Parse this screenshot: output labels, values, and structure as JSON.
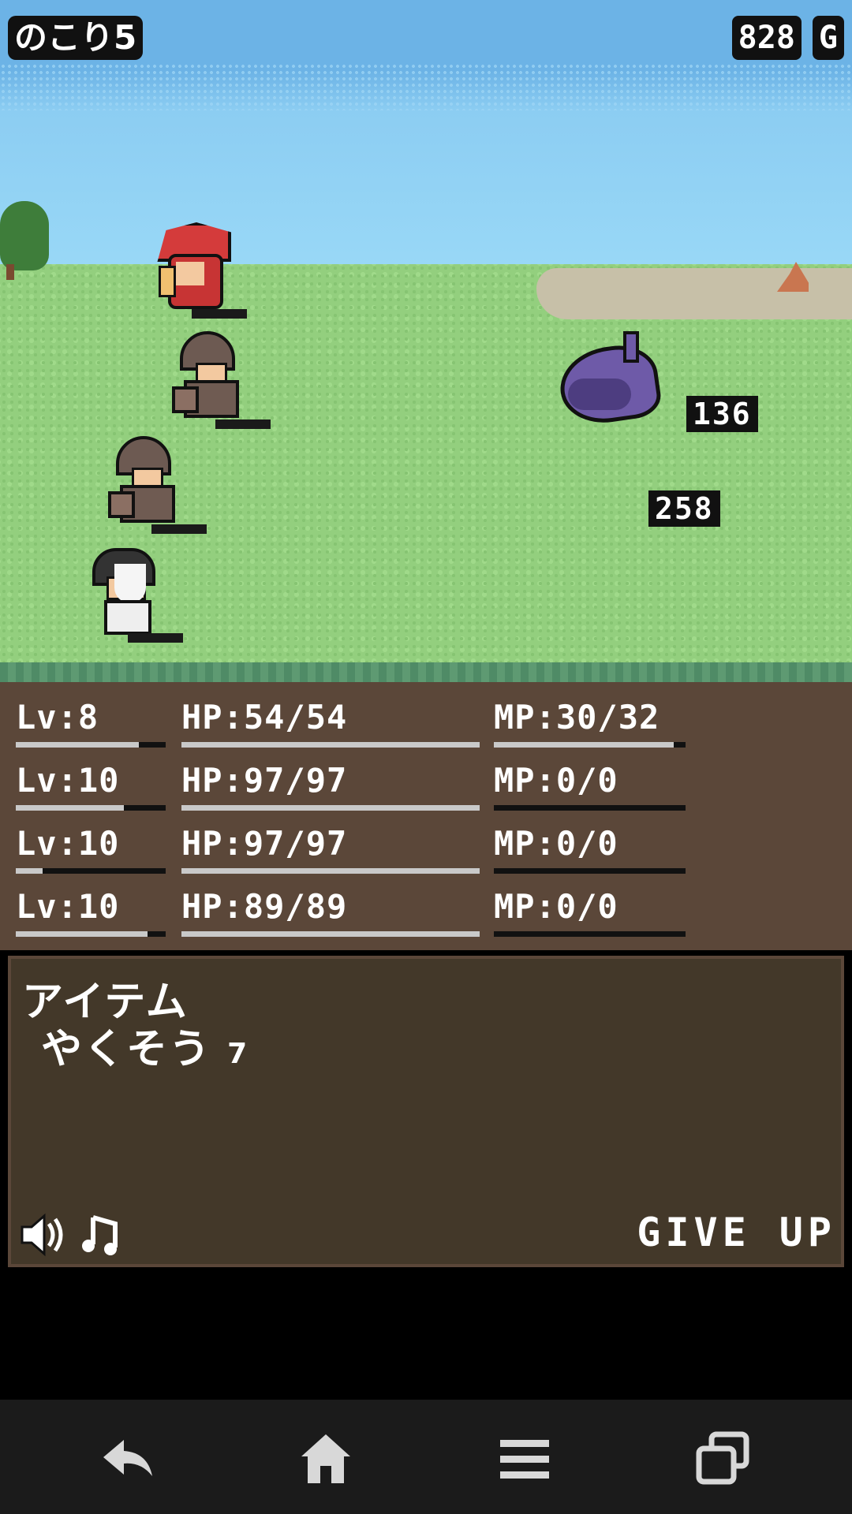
{
  "hud": {
    "remaining_label": "のこり5",
    "gold_value": "828",
    "gold_unit": "G"
  },
  "battle": {
    "damage_numbers": [
      "136",
      "258"
    ]
  },
  "party": [
    {
      "level": "Lv:8",
      "hp": "HP:54/54",
      "mp": "MP:30/32",
      "exp_fraction": 0.82,
      "hp_fraction": 1.0,
      "mp_fraction": 0.94
    },
    {
      "level": "Lv:10",
      "hp": "HP:97/97",
      "mp": "MP:0/0",
      "exp_fraction": 0.72,
      "hp_fraction": 1.0,
      "mp_fraction": 0
    },
    {
      "level": "Lv:10",
      "hp": "HP:97/97",
      "mp": "MP:0/0",
      "exp_fraction": 0.18,
      "hp_fraction": 1.0,
      "mp_fraction": 0
    },
    {
      "level": "Lv:10",
      "hp": "HP:89/89",
      "mp": "MP:0/0",
      "exp_fraction": 0.88,
      "hp_fraction": 1.0,
      "mp_fraction": 0
    }
  ],
  "message": {
    "line1": "アイテム",
    "line2": "やくそう",
    "line2_count": "7"
  },
  "controls": {
    "give_up_label": "GIVE UP",
    "sound_icon": "speaker-icon",
    "music_icon": "music-note-icon"
  },
  "navbar": {
    "icons": [
      "back-icon",
      "home-icon",
      "menu-icon",
      "recent-apps-icon"
    ]
  },
  "colors": {
    "sky": "#6cb3e6",
    "grass": "#93cf7e",
    "status_bg": "#5b4739",
    "message_bg": "#433829",
    "bar_fill": "#c9c9c9"
  }
}
